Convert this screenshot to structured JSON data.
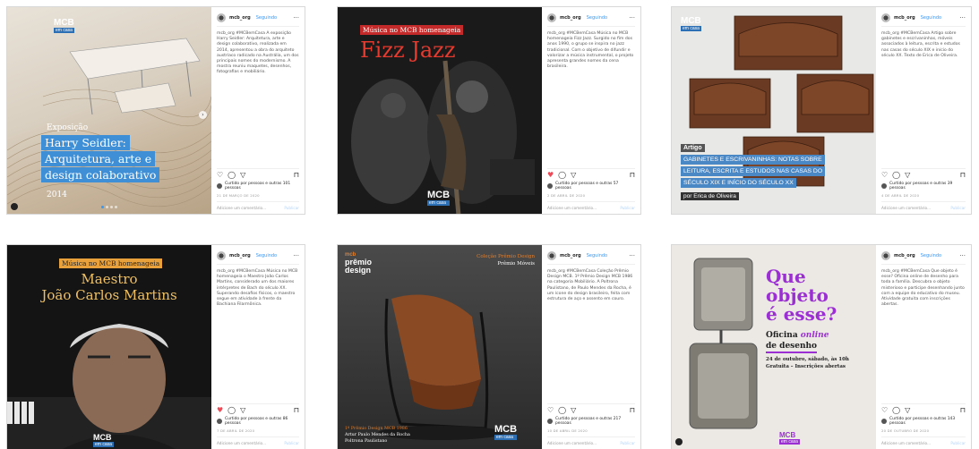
{
  "common": {
    "username": "mcb_org",
    "follow_label": "Seguindo",
    "more": "···",
    "comment_placeholder": "Adicione um comentário...",
    "publish": "Publicar"
  },
  "posts": [
    {
      "overlay": {
        "kicker": "Exposição",
        "title_lines": [
          "Harry Seidler:",
          "Arquitetura, arte e",
          "design colaborativo"
        ],
        "year": "2014",
        "logo": "MCB",
        "logo_sub": "em casa"
      },
      "caption": "mcb_org #MCBemCasa A exposição Harry Seidler: Arquitetura, arte e design colaborativo, realizada em 2014, apresentou a obra do arquiteto austríaco radicado na Austrália, um dos principais nomes do modernismo. A mostra reuniu maquetes, desenhos, fotografias e mobiliário.",
      "liked": "Curtido por pessoas e outras 101 pessoas",
      "date": "21 DE MARÇO DE 2020"
    },
    {
      "overlay": {
        "kicker": "Música no MCB homenageia",
        "title": "Fizz Jazz",
        "logo": "MCB",
        "logo_sub": "em casa"
      },
      "caption": "mcb_org #MCBemCasa Música no MCB homenageia Fizz Jazz. Surgido no fim dos anos 1990, o grupo se inspira no jazz tradicional. Com o objetivo de difundir e valorizar a música instrumental, o projeto apresenta grandes nomes da cena brasileira.",
      "liked": "Curtido por pessoas e outras 57 pessoas",
      "date": "2 DE ABRIL DE 2020"
    },
    {
      "overlay": {
        "kicker": "Artigo",
        "title_lines": [
          "GABINETES E ESCRIVANINHAS: NOTAS SOBRE",
          "LEITURA, ESCRITA E ESTUDOS NAS CASAS DO",
          "SÉCULO XIX E INÍCIO DO SÉCULO XX"
        ],
        "author": "por Erica de Oliveira",
        "logo": "MCB",
        "logo_sub": "em casa"
      },
      "caption": "mcb_org #MCBemCasa Artigo sobre gabinetes e escrivaninhas, móveis associados à leitura, escrita e estudos nas casas do século XIX e início do século XX. Texto de Erica de Oliveira.",
      "liked": "Curtido por pessoas e outras 39 pessoas",
      "date": "4 DE ABRIL DE 2020"
    },
    {
      "overlay": {
        "kicker": "Música no MCB homenageia",
        "title_lines": [
          "Maestro",
          "João Carlos Martins"
        ],
        "logo": "MCB",
        "logo_sub": "em casa"
      },
      "caption": "mcb_org #MCBemCasa Música no MCB homenageia o Maestro João Carlos Martins, considerado um dos maiores intérpretes de Bach do século XX. Superando desafios físicos, o maestro segue em atividade à frente da Bachiana Filarmônica.",
      "liked": "Curtido por pessoas e outras 86 pessoas",
      "date": "7 DE ABRIL DE 2020"
    },
    {
      "overlay": {
        "kicker": "prêmio",
        "kicker2": "design",
        "kicker_top": "mcb",
        "label_right": "Coleção Prêmio Design",
        "label_right2": "Prêmio Móveis",
        "footer_lines": [
          "1º Prêmio Design MCB 1986",
          "Artur Paulo Mendes da Rocha",
          "Poltrona Paulistano"
        ],
        "logo": "MCB",
        "logo_sub": "em casa"
      },
      "caption": "mcb_org #MCBemCasa Coleção Prêmio Design MCB. 1º Prêmio Design MCB 1986 na categoria Mobiliário. A Poltrona Paulistano, de Paulo Mendes da Rocha, é um ícone do design brasileiro, feita com estrutura de aço e assento em couro.",
      "liked": "Curtido por pessoas e outras 217 pessoas",
      "date": "10 DE ABRIL DE 2020"
    },
    {
      "overlay": {
        "title_lines": [
          "Que",
          "objeto",
          "é esse?"
        ],
        "subtitle_a": "Oficina ",
        "subtitle_b": "online",
        "subtitle_c": "de desenho",
        "detail": "24 de outubro, sábado, às 10h",
        "detail2": "Gratuita – Inscrições abertas",
        "logo": "MCB",
        "logo_sub": "em casa"
      },
      "caption": "mcb_org #MCBemCasa Que objeto é esse? Oficina online de desenho para toda a família. Descubra o objeto misterioso e participe desenhando junto com a equipe do educativo do museu. Atividade gratuita com inscrições abertas.",
      "liked": "Curtido por pessoas e outras 143 pessoas",
      "date": "20 DE OUTUBRO DE 2020"
    }
  ]
}
